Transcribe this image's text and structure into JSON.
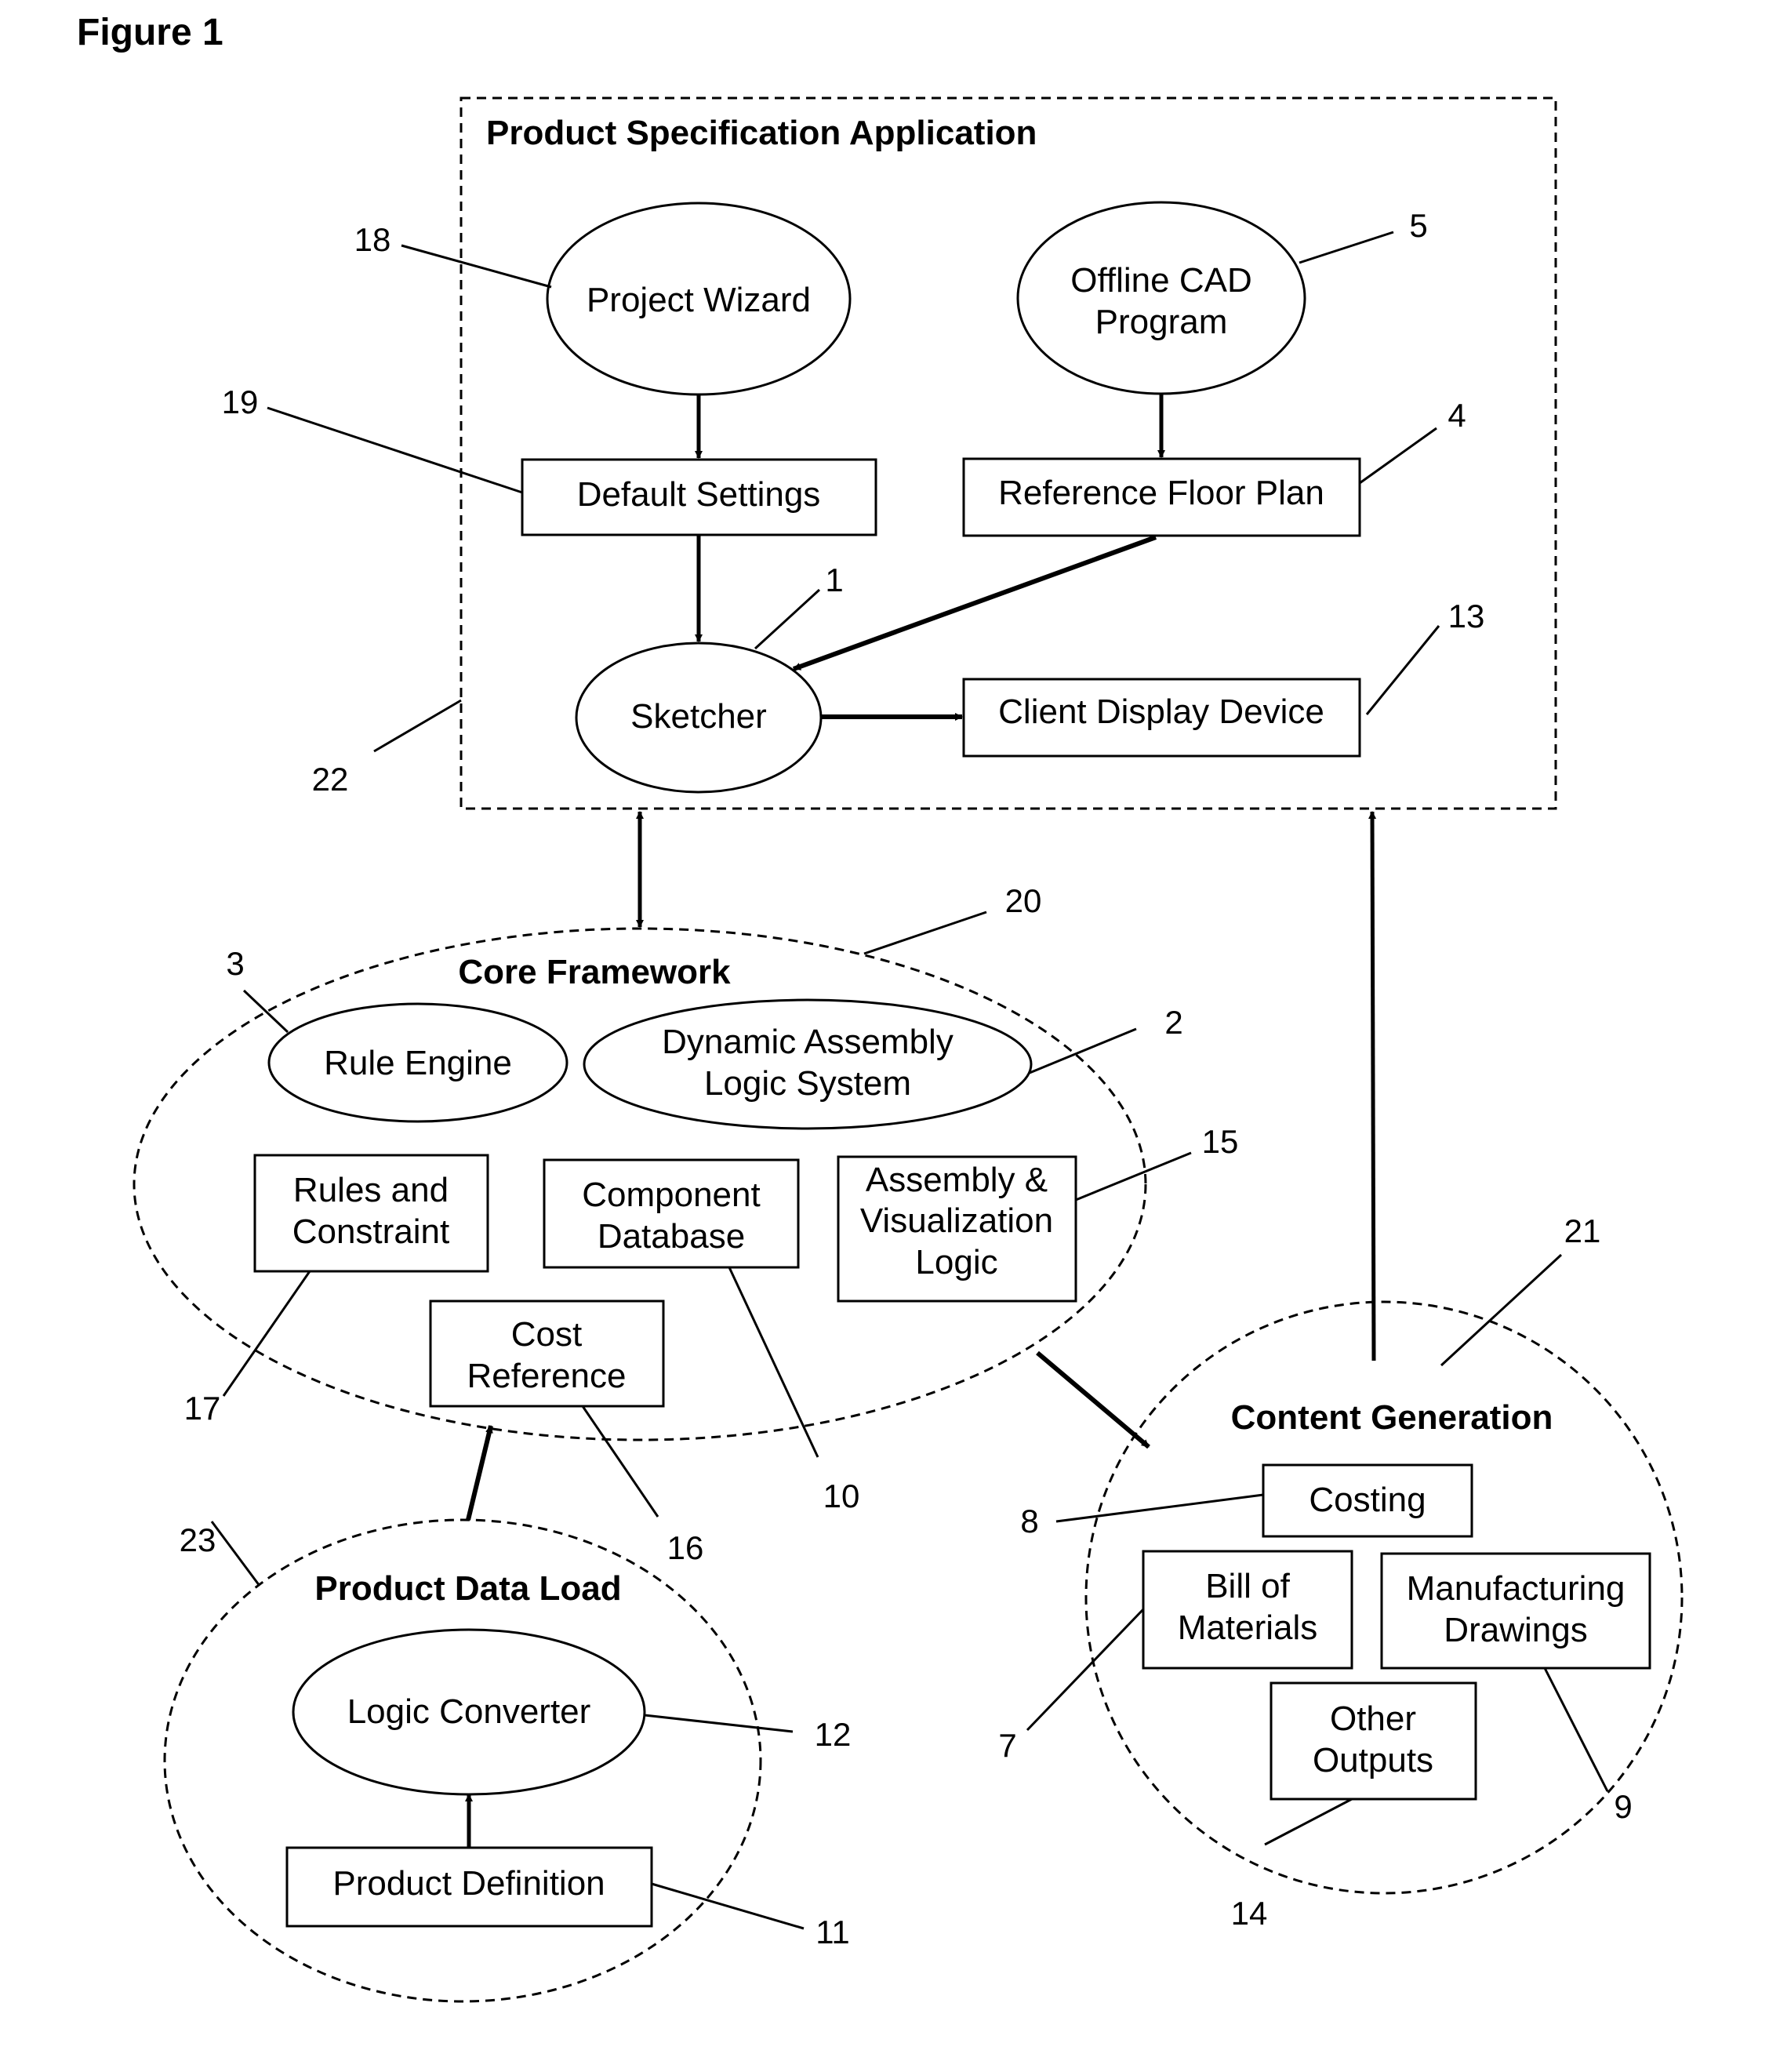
{
  "figure_title": "Figure 1",
  "groups": {
    "product_specification_application": {
      "label": "Product Specification Application",
      "ref": "22"
    },
    "core_framework": {
      "label": "Core Framework",
      "ref": "20"
    },
    "content_generation": {
      "label": "Content Generation",
      "ref": "21"
    },
    "product_data_load": {
      "label": "Product Data Load",
      "ref": "23"
    }
  },
  "nodes": {
    "project_wizard": {
      "lines": [
        "Project Wizard"
      ],
      "ref": "18",
      "shape": "ellipse"
    },
    "offline_cad": {
      "lines": [
        "Offline CAD",
        "Program"
      ],
      "ref": "5",
      "shape": "ellipse"
    },
    "default_settings": {
      "lines": [
        "Default Settings"
      ],
      "ref": "19",
      "shape": "box"
    },
    "reference_floor_plan": {
      "lines": [
        "Reference Floor Plan"
      ],
      "ref": "4",
      "shape": "box"
    },
    "sketcher": {
      "lines": [
        "Sketcher"
      ],
      "ref": "1",
      "shape": "ellipse"
    },
    "client_display": {
      "lines": [
        "Client Display Device"
      ],
      "ref": "13",
      "shape": "box"
    },
    "rule_engine": {
      "lines": [
        "Rule Engine"
      ],
      "ref": "3",
      "shape": "ellipse"
    },
    "dynamic_assembly": {
      "lines": [
        "Dynamic Assembly",
        "Logic System"
      ],
      "ref": "2",
      "shape": "ellipse"
    },
    "rules_constraint": {
      "lines": [
        "Rules and",
        "Constraint"
      ],
      "ref": "17",
      "shape": "box"
    },
    "component_db": {
      "lines": [
        "Component",
        "Database"
      ],
      "ref": "10",
      "shape": "box"
    },
    "assembly_vis": {
      "lines": [
        "Assembly &",
        "Visualization",
        "Logic"
      ],
      "ref": "15",
      "shape": "box"
    },
    "cost_reference": {
      "lines": [
        "Cost",
        "Reference"
      ],
      "ref": "16",
      "shape": "box"
    },
    "costing": {
      "lines": [
        "Costing"
      ],
      "ref": "8",
      "shape": "box"
    },
    "bill_of_materials": {
      "lines": [
        "Bill of",
        "Materials"
      ],
      "ref": "7",
      "shape": "box"
    },
    "manufacturing_drawings": {
      "lines": [
        "Manufacturing",
        "Drawings"
      ],
      "ref": "9",
      "shape": "box"
    },
    "other_outputs": {
      "lines": [
        "Other",
        "Outputs"
      ],
      "ref": "14",
      "shape": "box"
    },
    "logic_converter": {
      "lines": [
        "Logic Converter"
      ],
      "ref": "12",
      "shape": "ellipse"
    },
    "product_definition": {
      "lines": [
        "Product Definition"
      ],
      "ref": "11",
      "shape": "box"
    }
  }
}
